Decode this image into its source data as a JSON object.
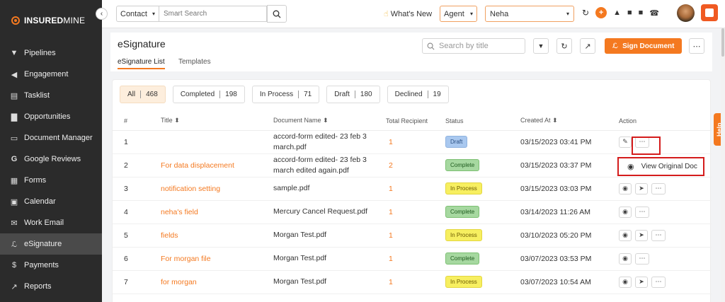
{
  "brand": {
    "name_bold": "INSURED",
    "name_light": "MINE",
    "accent": "#f47920"
  },
  "sidebar": {
    "items": [
      {
        "label": "Pipelines",
        "icon": "funnel-icon"
      },
      {
        "label": "Engagement",
        "icon": "megaphone-icon"
      },
      {
        "label": "Tasklist",
        "icon": "clipboard-icon"
      },
      {
        "label": "Opportunities",
        "icon": "bar-chart-icon"
      },
      {
        "label": "Document Manager",
        "icon": "folder-icon"
      },
      {
        "label": "Google Reviews",
        "icon": "google-icon"
      },
      {
        "label": "Forms",
        "icon": "form-icon"
      },
      {
        "label": "Calendar",
        "icon": "calendar-icon"
      },
      {
        "label": "Work Email",
        "icon": "mail-icon"
      },
      {
        "label": "eSignature",
        "icon": "signature-icon",
        "active": true
      },
      {
        "label": "Payments",
        "icon": "dollar-icon"
      },
      {
        "label": "Reports",
        "icon": "line-chart-icon"
      }
    ]
  },
  "topbar": {
    "contact_select": "Contact",
    "search_placeholder": "Smart Search",
    "whats_new": "What's New",
    "agent_select": "Agent",
    "user_select": "Neha"
  },
  "page": {
    "title": "eSignature",
    "tabs": [
      "eSignature List",
      "Templates"
    ],
    "search_placeholder": "Search by title",
    "sign_button": "Sign Document"
  },
  "filters": [
    {
      "label": "All",
      "count": "468",
      "active": true
    },
    {
      "label": "Completed",
      "count": "198"
    },
    {
      "label": "In Process",
      "count": "71"
    },
    {
      "label": "Draft",
      "count": "180"
    },
    {
      "label": "Declined",
      "count": "19"
    }
  ],
  "table": {
    "headers": [
      "#",
      "Title ⬍",
      "Document Name ⬍",
      "Total Recipient",
      "Status",
      "Created At ⬍",
      "Action"
    ],
    "rows": [
      {
        "num": "1",
        "title": "",
        "doc": "accord-form edited- 23 feb 3 march.pdf",
        "recipients": "1",
        "status": "Draft",
        "status_type": "draft",
        "created": "03/15/2023 03:41 PM",
        "actions": [
          "edit",
          "more"
        ]
      },
      {
        "num": "2",
        "title": "For data displacement",
        "doc": "accord-form edited- 23 feb 3 march edited again.pdf",
        "recipients": "2",
        "status": "Complete",
        "status_type": "complete",
        "created": "03/15/2023 03:37 PM",
        "actions": []
      },
      {
        "num": "3",
        "title": "notification setting",
        "doc": "sample.pdf",
        "recipients": "1",
        "status": "In Process",
        "status_type": "inprocess",
        "created": "03/15/2023 03:03 PM",
        "actions": [
          "view",
          "send",
          "more"
        ]
      },
      {
        "num": "4",
        "title": "neha's field",
        "doc": "Mercury Cancel Request.pdf",
        "recipients": "1",
        "status": "Complete",
        "status_type": "complete",
        "created": "03/14/2023 11:26 AM",
        "actions": [
          "view",
          "more"
        ]
      },
      {
        "num": "5",
        "title": "fields",
        "doc": "Morgan Test.pdf",
        "recipients": "1",
        "status": "In Process",
        "status_type": "inprocess",
        "created": "03/10/2023 05:20 PM",
        "actions": [
          "view",
          "send",
          "more"
        ]
      },
      {
        "num": "6",
        "title": "For morgan file",
        "doc": "Morgan Test.pdf",
        "recipients": "1",
        "status": "Complete",
        "status_type": "complete",
        "created": "03/07/2023 03:53 PM",
        "actions": [
          "view",
          "more"
        ]
      },
      {
        "num": "7",
        "title": "for morgan",
        "doc": "Morgan Test.pdf",
        "recipients": "1",
        "status": "In Process",
        "status_type": "inprocess",
        "created": "03/07/2023 10:54 AM",
        "actions": [
          "view",
          "send",
          "more"
        ]
      }
    ]
  },
  "dropdown": {
    "label": "View Original Doc"
  },
  "help_tab": "Help"
}
